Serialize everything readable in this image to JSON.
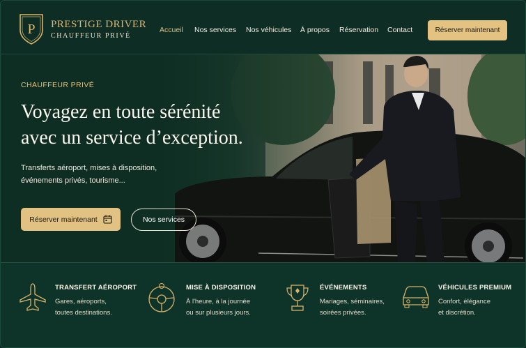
{
  "brand": {
    "name": "PRESTIGE DRIVER",
    "subtitle": "CHAUFFEUR PRIVÉ",
    "logo_letter": "P"
  },
  "nav": {
    "items": [
      "Accueil",
      "Nos services",
      "Nos véhicules",
      "À propos",
      "Réservation",
      "Contact"
    ],
    "active": "Accueil"
  },
  "header_cta": "Réserver maintenant",
  "hero": {
    "eyebrow": "CHAUFFEUR PRIVÉ",
    "title_line1": "Voyagez en toute sérénité",
    "title_line2": "avec un service d’exception.",
    "lead_line1": "Transferts aéroport, mises à disposition,",
    "lead_line2": "événements privés, tourisme...",
    "primary_button": "Réserver maintenant",
    "secondary_button": "Nos services"
  },
  "features": [
    {
      "icon": "airplane-icon",
      "title": "TRANSFERT AÉROPORT",
      "desc1": "Gares, aéroports,",
      "desc2": "toutes destinations."
    },
    {
      "icon": "steering-wheel-icon",
      "title": "MISE À DISPOSITION",
      "desc1": "À l'heure, à la journée",
      "desc2": "ou sur plusieurs jours."
    },
    {
      "icon": "trophy-icon",
      "title": "ÉVÉNEMENTS",
      "desc1": "Mariages, séminaires,",
      "desc2": "soirées privées."
    },
    {
      "icon": "car-icon",
      "title": "VÉHICULES PREMIUM",
      "desc1": "Confort, élégance",
      "desc2": "et discrétion."
    }
  ],
  "colors": {
    "accent": "#e2c282",
    "background": "#0d2b22"
  }
}
